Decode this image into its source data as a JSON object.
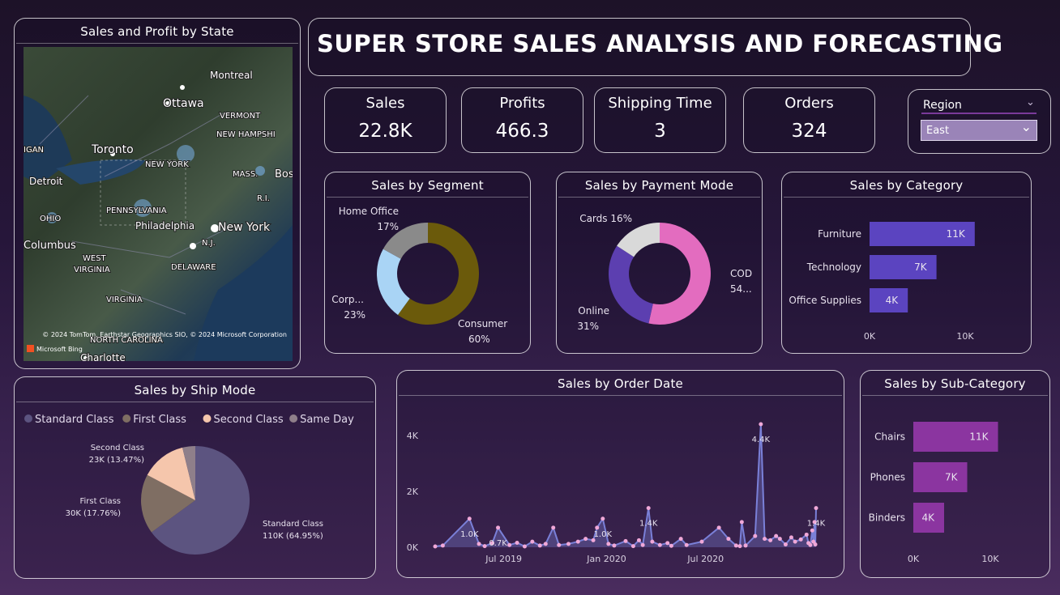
{
  "header": {
    "title": "SUPER STORE SALES ANALYSIS AND FORECASTING"
  },
  "map": {
    "title": "Sales and Profit by State",
    "labels": [
      "Montreal",
      "Ottawa",
      "VERMONT",
      "NEW HAMPSHI",
      "IGAN",
      "Toronto",
      "NEW YORK",
      "Detroit",
      "MASS.",
      "Bos",
      "R.I.",
      "PENNSYLVANIA",
      "OHIO",
      "Philadelphia",
      "New York",
      "Columbus",
      "N.J.",
      "WEST",
      "VIRGINIA",
      "DELAWARE",
      "VIRGINIA",
      "NORTH CAROLINA",
      "Charlotte"
    ],
    "attribution": "© 2024 TomTom, Earthstar Geographics SIO, © 2024 Microsoft Corporation",
    "logo": "Microsoft Bing"
  },
  "kpis": [
    {
      "label": "Sales",
      "value": "22.8K"
    },
    {
      "label": "Profits",
      "value": "466.3"
    },
    {
      "label": "Shipping Time",
      "value": "3"
    },
    {
      "label": "Orders",
      "value": "324"
    }
  ],
  "filter": {
    "label": "Region",
    "selected": "East"
  },
  "colors": {
    "consumer": "#6b5a0b",
    "corporate": "#a9d4f5",
    "home_office": "#8a8a8a",
    "cod": "#e36cbf",
    "online": "#5c3fb0",
    "cards": "#d9d9d9",
    "category_bar": "#5b44c0",
    "subcategory_bar": "#8b35a0",
    "standard": "#5c5480",
    "first": "#7f6e63",
    "second": "#f5c6ac",
    "same_day": "#8f7f8a",
    "line": "#7a80d8",
    "marker": "#f0a8d8"
  },
  "segment_chart": {
    "title": "Sales by Segment",
    "type": "pie",
    "slices": [
      {
        "name": "Consumer",
        "value": 60,
        "label_top": "Consumer",
        "label_bottom": "60%"
      },
      {
        "name": "Corporate",
        "value": 23,
        "label_top": "Corp...",
        "label_bottom": "23%"
      },
      {
        "name": "Home Office",
        "value": 17,
        "label_top": "Home Office",
        "label_bottom": "17%"
      }
    ]
  },
  "payment_chart": {
    "title": "Sales by Payment Mode",
    "type": "pie",
    "slices": [
      {
        "name": "COD",
        "value": 54,
        "label_top": "COD",
        "label_bottom": "54..."
      },
      {
        "name": "Online",
        "value": 31,
        "label_top": "Online",
        "label_bottom": "31%"
      },
      {
        "name": "Cards",
        "value": 16,
        "label_top": "Cards 16%",
        "label_bottom": ""
      }
    ]
  },
  "category_chart": {
    "title": "Sales by Category",
    "type": "bar",
    "categories": [
      "Furniture",
      "Technology",
      "Office Supplies"
    ],
    "values": [
      11,
      7,
      4
    ],
    "value_labels": [
      "11K",
      "7K",
      "4K"
    ],
    "x_ticks": [
      "0K",
      "10K"
    ],
    "xlim": [
      0,
      10
    ]
  },
  "shipmode_chart": {
    "title": "Sales by Ship Mode",
    "type": "pie",
    "legend": [
      "Standard Class",
      "First Class",
      "Second Class",
      "Same Day"
    ],
    "slices": [
      {
        "name": "Standard Class",
        "value": 64.95,
        "label_top": "Standard Class",
        "label_bottom": "110K (64.95%)"
      },
      {
        "name": "First Class",
        "value": 17.76,
        "label_top": "First Class",
        "label_bottom": "30K (17.76%)"
      },
      {
        "name": "Second Class",
        "value": 13.47,
        "label_top": "Second Class",
        "label_bottom": "23K (13.47%)"
      },
      {
        "name": "Same Day",
        "value": 3.82,
        "label_top": "",
        "label_bottom": ""
      }
    ]
  },
  "orderdate_chart": {
    "title": "Sales by Order Date",
    "type": "line",
    "y_ticks": [
      "0K",
      "2K",
      "4K"
    ],
    "ylim": [
      0,
      4400
    ],
    "x_ticks": [
      "Jul 2019",
      "Jan 2020",
      "Jul 2020"
    ],
    "x_tick_positions": [
      0.18,
      0.45,
      0.71
    ],
    "points": [
      [
        0.0,
        30
      ],
      [
        0.02,
        60
      ],
      [
        0.09,
        1020
      ],
      [
        0.115,
        120
      ],
      [
        0.13,
        40
      ],
      [
        0.15,
        150
      ],
      [
        0.165,
        700
      ],
      [
        0.195,
        80
      ],
      [
        0.215,
        160
      ],
      [
        0.235,
        30
      ],
      [
        0.255,
        200
      ],
      [
        0.275,
        60
      ],
      [
        0.29,
        120
      ],
      [
        0.31,
        700
      ],
      [
        0.325,
        80
      ],
      [
        0.35,
        120
      ],
      [
        0.375,
        200
      ],
      [
        0.395,
        300
      ],
      [
        0.415,
        250
      ],
      [
        0.425,
        700
      ],
      [
        0.44,
        1020
      ],
      [
        0.455,
        120
      ],
      [
        0.47,
        60
      ],
      [
        0.5,
        220
      ],
      [
        0.52,
        40
      ],
      [
        0.535,
        250
      ],
      [
        0.545,
        80
      ],
      [
        0.56,
        1400
      ],
      [
        0.57,
        200
      ],
      [
        0.59,
        80
      ],
      [
        0.61,
        150
      ],
      [
        0.62,
        50
      ],
      [
        0.645,
        300
      ],
      [
        0.66,
        80
      ],
      [
        0.7,
        200
      ],
      [
        0.745,
        700
      ],
      [
        0.77,
        300
      ],
      [
        0.79,
        60
      ],
      [
        0.8,
        40
      ],
      [
        0.805,
        900
      ],
      [
        0.815,
        60
      ],
      [
        0.84,
        400
      ],
      [
        0.855,
        4400
      ],
      [
        0.865,
        300
      ],
      [
        0.88,
        250
      ],
      [
        0.895,
        400
      ],
      [
        0.905,
        300
      ],
      [
        0.92,
        100
      ],
      [
        0.935,
        350
      ],
      [
        0.945,
        200
      ],
      [
        0.96,
        280
      ],
      [
        0.975,
        450
      ],
      [
        0.98,
        150
      ],
      [
        0.985,
        80
      ],
      [
        0.99,
        600
      ],
      [
        0.993,
        200
      ],
      [
        0.996,
        900
      ],
      [
        0.998,
        100
      ],
      [
        1.0,
        1400
      ]
    ],
    "data_labels": [
      {
        "x": 0.09,
        "y": 1020,
        "text": "1.0K"
      },
      {
        "x": 0.165,
        "y": 700,
        "text": "0.7K"
      },
      {
        "x": 0.44,
        "y": 1020,
        "text": "1.0K"
      },
      {
        "x": 0.56,
        "y": 1400,
        "text": "1.4K"
      },
      {
        "x": 0.855,
        "y": 4400,
        "text": "4.4K"
      },
      {
        "x": 1.0,
        "y": 1400,
        "text": "1.4K"
      }
    ]
  },
  "subcategory_chart": {
    "title": "Sales by Sub-Category",
    "type": "bar",
    "categories": [
      "Chairs",
      "Phones",
      "Binders"
    ],
    "values": [
      11,
      7,
      4
    ],
    "value_labels": [
      "11K",
      "7K",
      "4K"
    ],
    "x_ticks": [
      "0K",
      "10K"
    ],
    "xlim": [
      0,
      10
    ]
  }
}
